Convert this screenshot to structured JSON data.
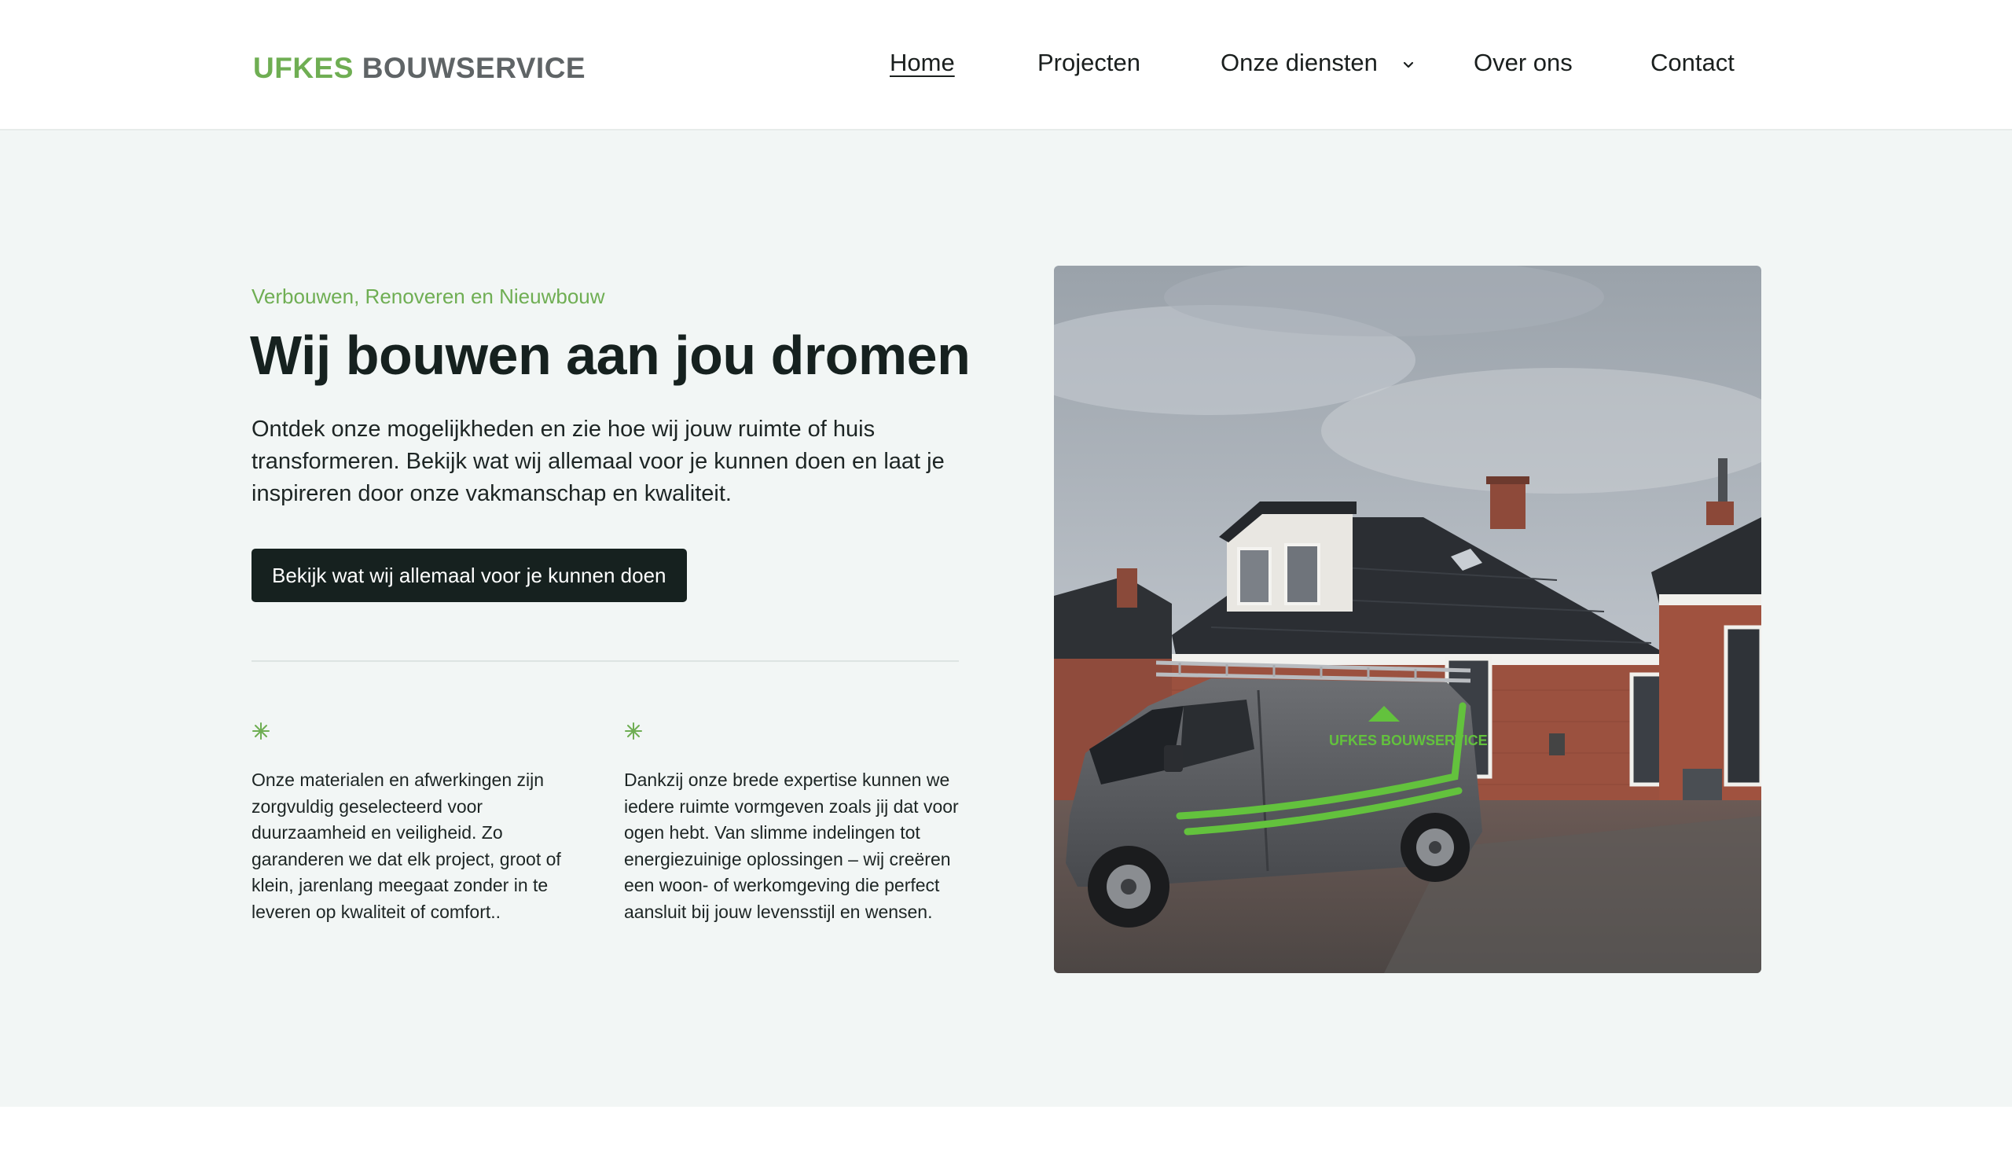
{
  "header": {
    "logo_part1": "UFKES",
    "logo_part2": "BOUWSERVICE",
    "nav": {
      "home": "Home",
      "projecten": "Projecten",
      "onze_diensten": "Onze diensten",
      "over_ons": "Over ons",
      "contact": "Contact"
    }
  },
  "hero": {
    "eyebrow": "Verbouwen, Renoveren en Nieuwbouw",
    "title": "Wij bouwen aan jou dromen",
    "lead": "Ontdek onze mogelijkheden en zie hoe wij jouw ruimte of huis transformeren. Bekijk wat wij allemaal voor je kunnen doen en laat je inspireren door onze vakmanschap en kwaliteit.",
    "cta_label": "Bekijk wat wij allemaal voor je kunnen doen",
    "features": [
      {
        "icon": "sparkle-icon",
        "text": "Onze materialen en afwerkingen zijn zorgvuldig geselecteerd voor duurzaamheid en veiligheid. Zo garanderen we dat elk project, groot of klein, jarenlang meegaat zonder in te leveren op kwaliteit of comfort.."
      },
      {
        "icon": "sparkle-icon",
        "text": "Dankzij onze brede expertise kunnen we iedere ruimte vormgeven zoals jij dat voor ogen hebt. Van slimme indelingen tot energiezuinige oplossingen – wij creëren een woon- of werkomgeving die perfect aansluit bij jouw levensstijl en wensen."
      }
    ],
    "photo": {
      "van_logo_text": "UFKES BOUWSERVICE",
      "icon": "house-van-photo"
    }
  },
  "colors": {
    "accent_green": "#6fae53",
    "logo_grey": "#5f6466",
    "dark": "#16211f",
    "hero_background": "#f2f6f5"
  }
}
